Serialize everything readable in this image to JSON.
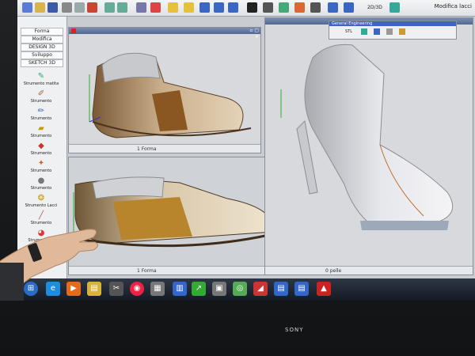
{
  "menu_labels": [
    "Forma",
    "Modifica",
    "DESIGN 3D",
    "Sviluppo",
    "SKETCH 3D"
  ],
  "tools": [
    {
      "label": "Strumento matita",
      "icon": "pencil-icon"
    },
    {
      "label": "Strumento",
      "icon": "brush-icon"
    },
    {
      "label": "Strumento",
      "icon": "pen-icon"
    },
    {
      "label": "Strumento",
      "icon": "marker-icon"
    },
    {
      "label": "Strumento",
      "icon": "eraser-icon"
    },
    {
      "label": "Strumento",
      "icon": "shape-icon"
    },
    {
      "label": "Strumento",
      "icon": "blob-icon"
    },
    {
      "label": "Strumento Lacci",
      "icon": "lace-icon"
    },
    {
      "label": "Strumento",
      "icon": "dropper-icon"
    },
    {
      "label": "Strumento gr",
      "icon": "palette-icon"
    }
  ],
  "top_right": {
    "mode": "2D/3D",
    "action": "Modifica lacci"
  },
  "floating_toolbar_title": "General Engineering",
  "floating_toolbar_code": "STL",
  "viewports": [
    {
      "label": "1 Forma"
    },
    {
      "label": "1 Forma"
    },
    {
      "label": "0 pelle"
    }
  ],
  "tv_brand": "SONY"
}
